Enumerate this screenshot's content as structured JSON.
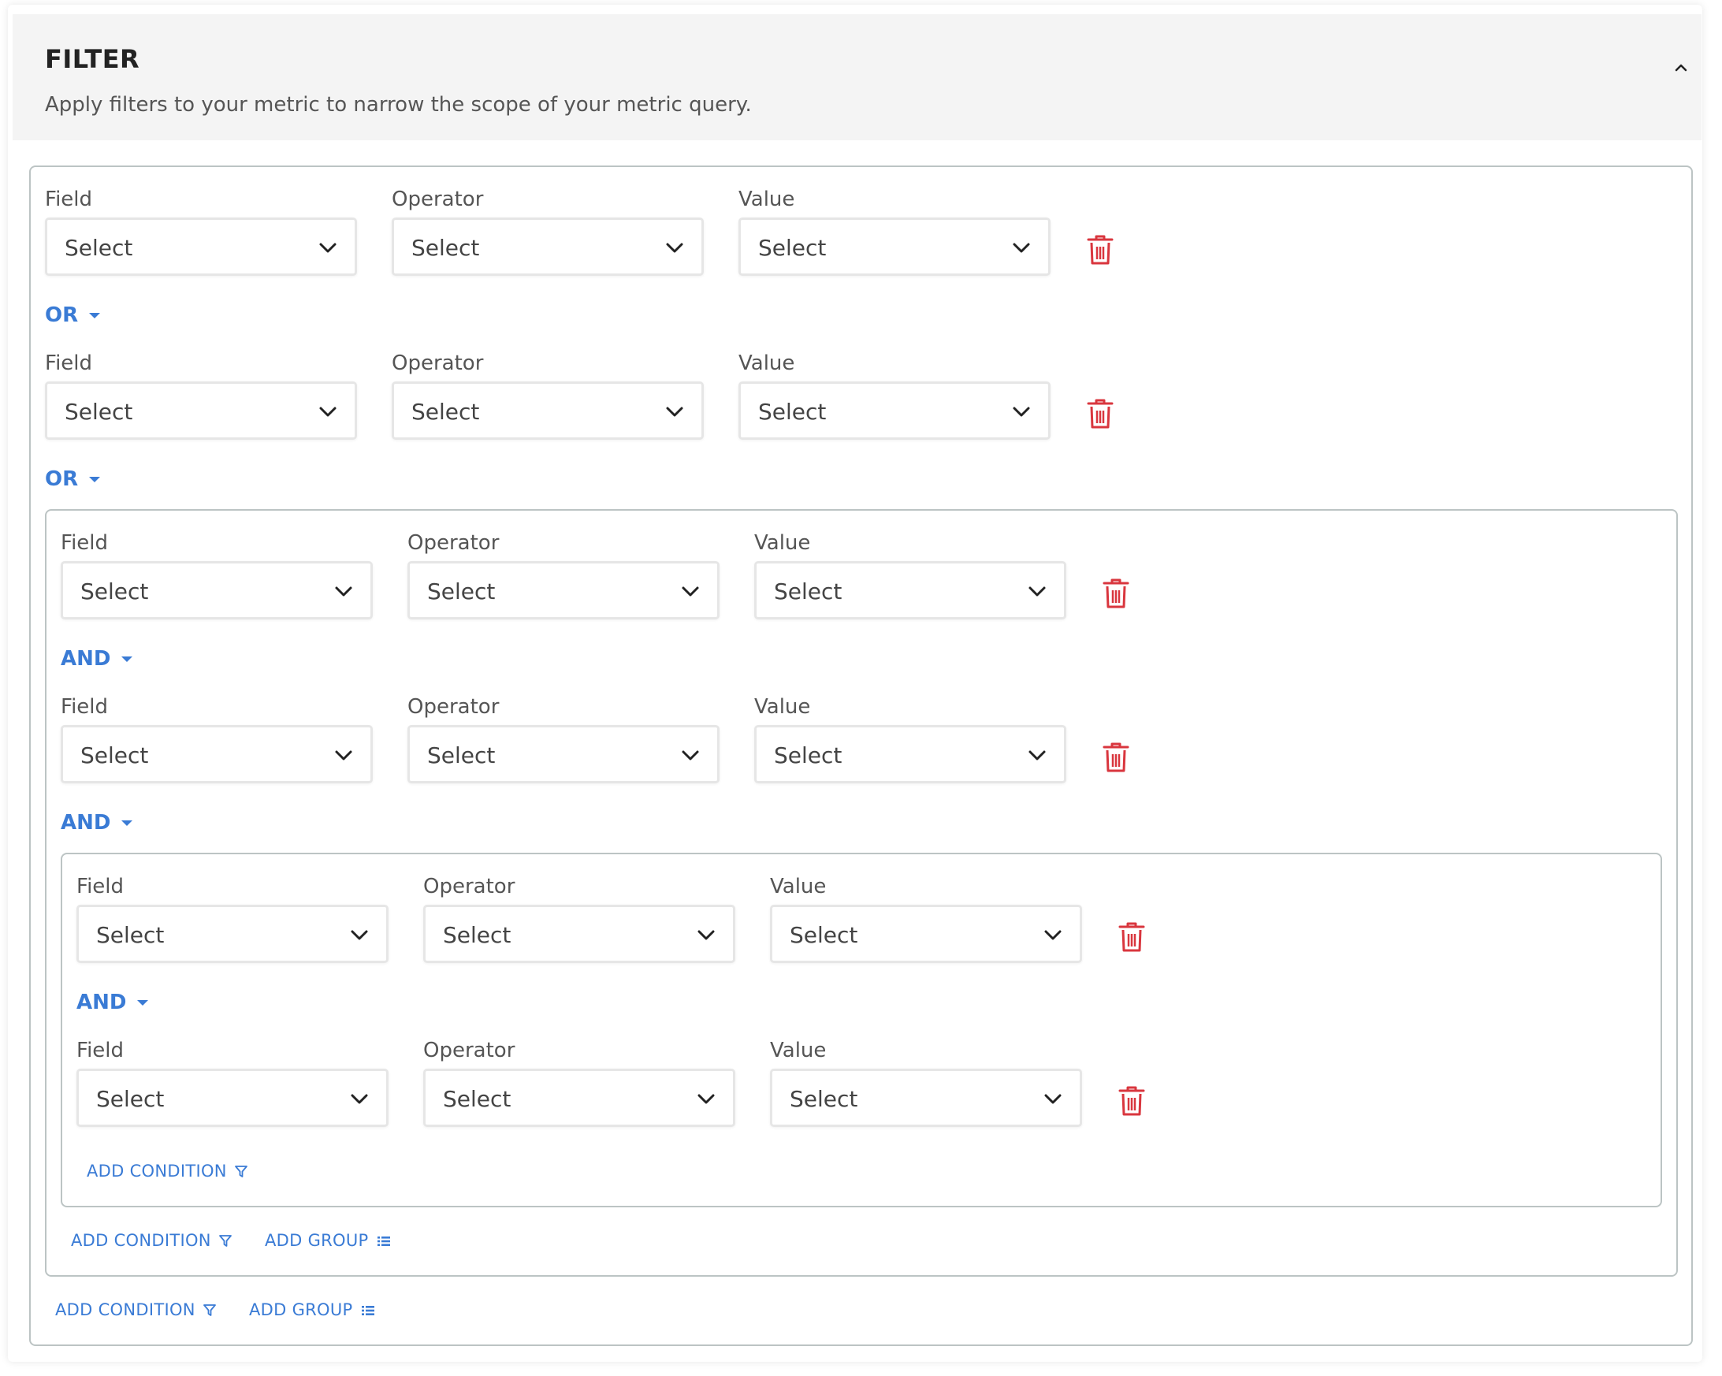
{
  "header": {
    "title": "FILTER",
    "subtitle": "Apply filters to your metric to narrow the scope of your metric query."
  },
  "labels": {
    "field": "Field",
    "operator": "Operator",
    "value": "Value",
    "select_placeholder": "Select"
  },
  "conjunctions": {
    "or_1": "OR",
    "or_2": "OR",
    "and_1": "AND",
    "and_2": "AND",
    "and_3": "AND"
  },
  "actions": {
    "add_condition": "ADD CONDITION",
    "add_group": "ADD GROUP"
  },
  "colors": {
    "accent": "#3a7bd5",
    "delete": "#d9363e",
    "header_bg": "#f4f4f4",
    "border": "#bcc4c4"
  },
  "icons": {
    "collapse": "chevron-up-icon",
    "dropdown": "chevron-down-icon",
    "delete": "trash-icon",
    "add_condition": "filter-icon",
    "add_group": "list-icon"
  }
}
